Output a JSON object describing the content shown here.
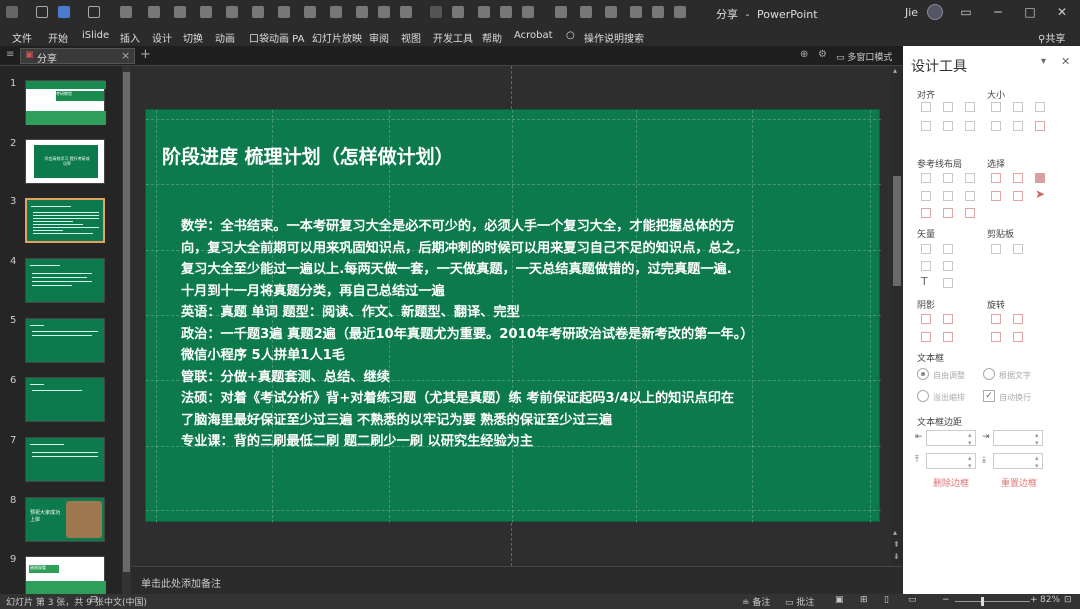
{
  "window": {
    "doc_title": "分享",
    "app_name": "PowerPoint",
    "user": "Jie",
    "share_label": "共享"
  },
  "ribbon": {
    "tabs": [
      "文件",
      "开始",
      "iSlide",
      "插入",
      "设计",
      "切换",
      "动画",
      "口袋动画 PA",
      "幻灯片放映",
      "审阅",
      "视图",
      "开发工具",
      "帮助",
      "Acrobat",
      "操作说明搜索"
    ]
  },
  "doc_tab": {
    "label": "分享",
    "close": "×",
    "add": "+"
  },
  "view_bar": {
    "multi_window": "多窗口模式"
  },
  "thumbnails": [
    {
      "num": "1",
      "text": "考研教程"
    },
    {
      "num": "2",
      "text": "学会高效学习 提升考研成功率"
    },
    {
      "num": "3",
      "text": ""
    },
    {
      "num": "4",
      "text": ""
    },
    {
      "num": "5",
      "text": ""
    },
    {
      "num": "6",
      "text": ""
    },
    {
      "num": "7",
      "text": ""
    },
    {
      "num": "8",
      "text": "预祝大家成功上岸"
    },
    {
      "num": "9",
      "text": "谢谢观看"
    }
  ],
  "slide": {
    "title": "阶段进度  梳理计划（怎样做计划）",
    "lines": [
      "数学：全书结束。一本考研复习大全是必不可少的，必须人手一个复习大全，才能把握总体的方",
      "向，复习大全前期可以用来巩固知识点，后期冲刺的时候可以用来夏习自己不足的知识点，总之，",
      "复习大全至少能过一遍以上.每两天做一套，一天做真题，一天总结真题做错的，过完真题一遍.",
      "十月到十一月将真题分类，再自己总结过一遍",
      "英语：真题  单词   题型：阅读、作文、新题型、翻译、完型",
      "政治：一千题3遍  真题2遍（最近10年真题尤为重要。2010年考研政治试卷是新考改的第一年。）",
      "微信小程序  5人拼单1人1毛",
      "管联：分做+真题套测、总结、继续",
      "法硕：对着《考试分析》背+对着练习题（尤其是真题）练    考前保证起码3/4以上的知识点印在",
      "了脑海里最好保证至少过三遍      不熟悉的以牢记为要  熟悉的保证至少过三遍",
      "专业课：背的三刷最低二刷   题二刷少一刷   以研究生经验为主"
    ]
  },
  "notes": {
    "placeholder": "单击此处添加备注"
  },
  "design_pane": {
    "title": "设计工具",
    "sections": {
      "align": "对齐",
      "size": "大小",
      "guides": "参考线布局",
      "select": "选择",
      "vector": "矢量",
      "clipboard": "剪贴板",
      "shadow": "阴影",
      "rotate": "旋转",
      "textbox": "文本框",
      "textbox_margin": "文本框边距"
    },
    "textbox_options": {
      "autofit": "自由调整",
      "fit_text": "根据文字",
      "overflow": "溢出缩排",
      "wrap": "自动换行"
    },
    "buttons": {
      "clear_margin": "删除边框",
      "reset_margin": "重置边框"
    }
  },
  "status": {
    "slide_info": "幻灯片 第 3 张，共 9 张",
    "language": "中文(中国)",
    "notes": "备注",
    "comments": "批注",
    "zoom": "82%"
  },
  "colors": {
    "slide_bg": "#0d7a4d",
    "app_bg": "#2b2b2b",
    "pane_bg": "#ffffff",
    "accent_pink": "#e5a4a4"
  }
}
